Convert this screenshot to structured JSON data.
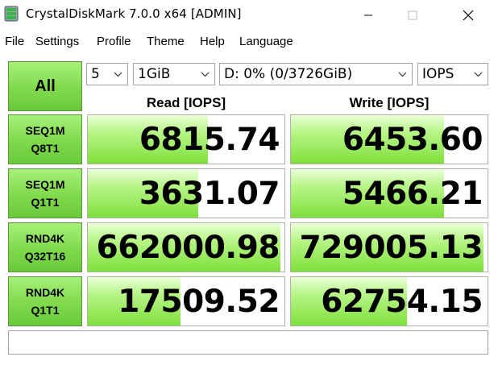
{
  "window": {
    "title": "CrystalDiskMark 7.0.0 x64 [ADMIN]"
  },
  "menu": [
    "File",
    "Settings",
    "Profile",
    "Theme",
    "Help",
    "Language"
  ],
  "controls": {
    "all_label": "All",
    "count": "5",
    "size": "1GiB",
    "drive": "D: 0% (0/3726GiB)",
    "unit": "IOPS"
  },
  "headers": {
    "read": "Read [IOPS]",
    "write": "Write [IOPS]"
  },
  "rows": [
    {
      "line1": "SEQ1M",
      "line2": "Q8T1",
      "read": "6815.74",
      "write": "6453.60",
      "read_fill": 0.61,
      "write_fill": 0.78
    },
    {
      "line1": "SEQ1M",
      "line2": "Q1T1",
      "read": "3631.07",
      "write": "5466.21",
      "read_fill": 0.56,
      "write_fill": 0.78
    },
    {
      "line1": "RND4K",
      "line2": "Q32T16",
      "read": "662000.98",
      "write": "729005.13",
      "read_fill": 0.98,
      "write_fill": 0.98
    },
    {
      "line1": "RND4K",
      "line2": "Q1T1",
      "read": "17509.52",
      "write": "62754.15",
      "read_fill": 0.47,
      "write_fill": 0.59
    }
  ],
  "comment": "",
  "colors": {
    "button_green": "#7fda4a",
    "bar_green": "#7fe03c"
  }
}
